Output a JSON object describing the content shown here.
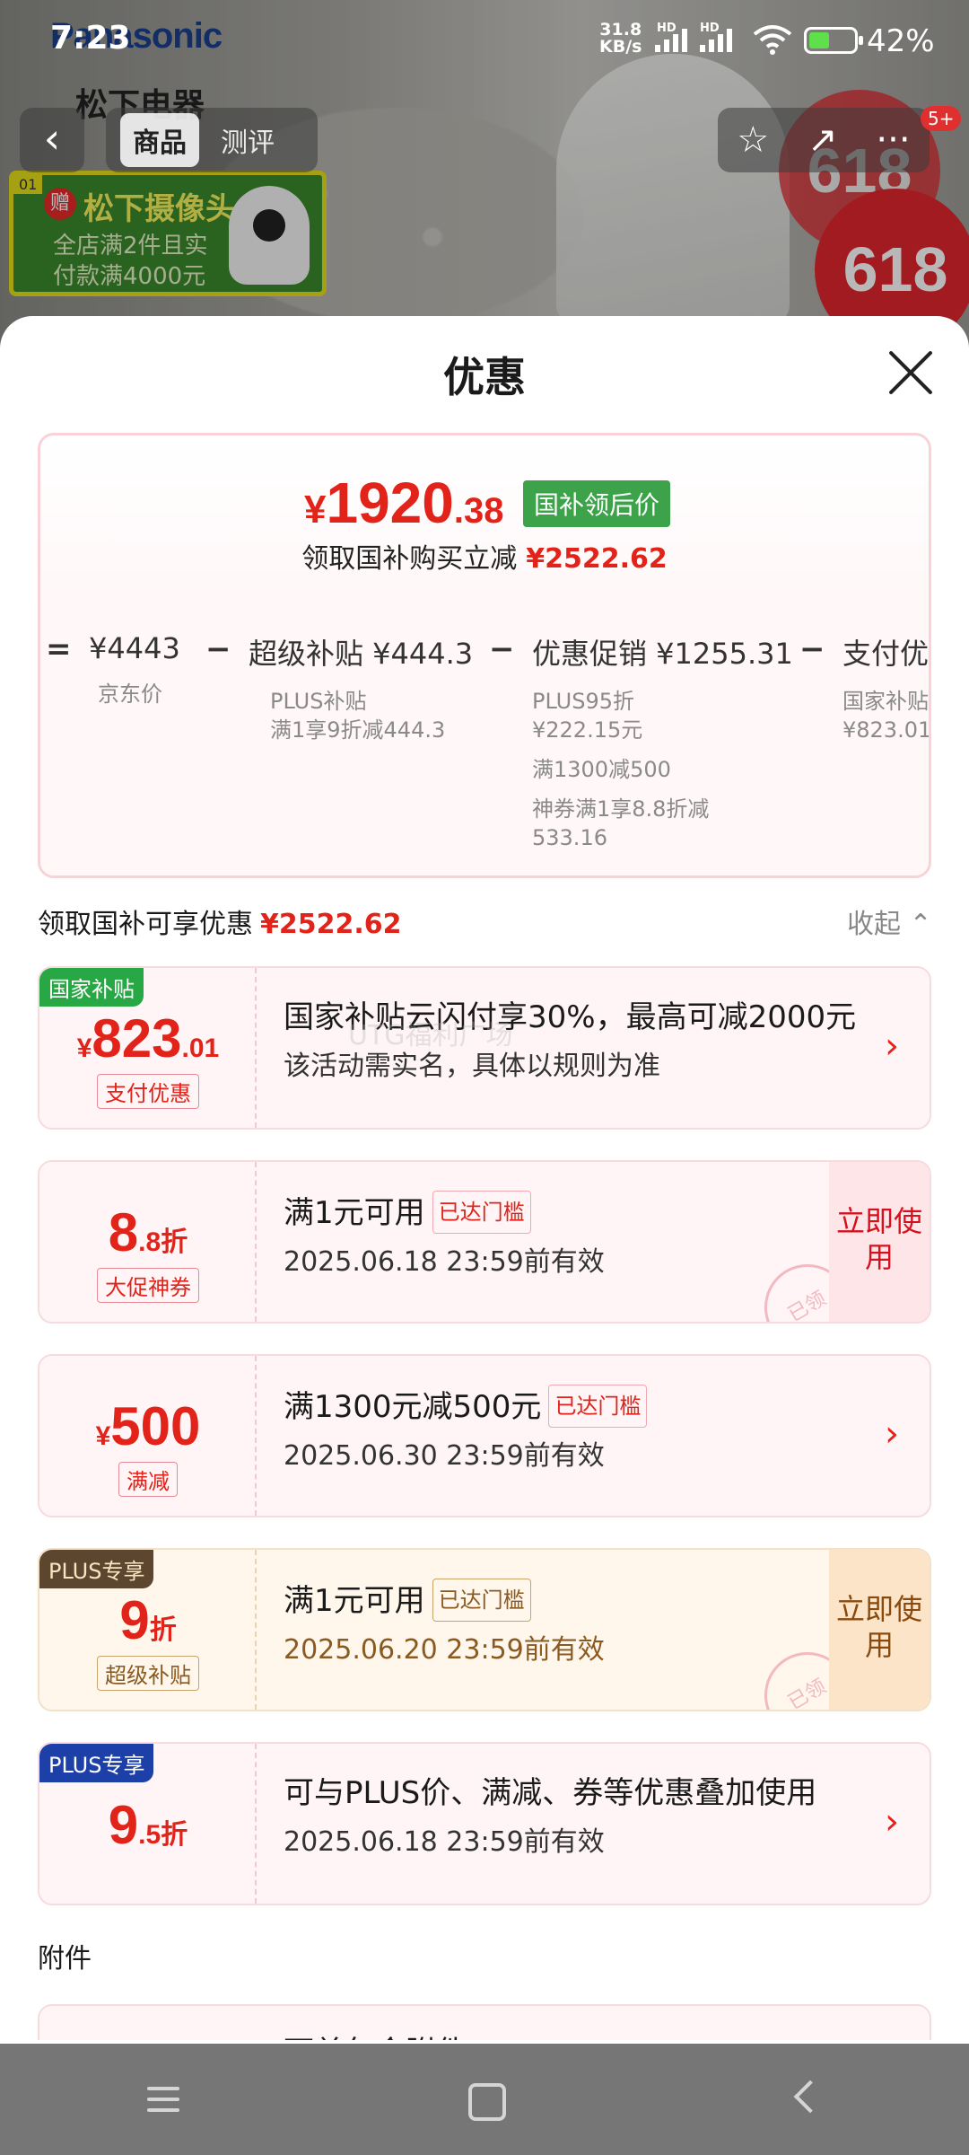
{
  "status_bar": {
    "time": "7:23",
    "net_speed": "31.8",
    "net_unit": "KB/s",
    "hd1": "HD",
    "hd2": "HD",
    "battery_pct": "42%"
  },
  "background": {
    "brand": "Panasonic",
    "brand_cn": "松下电器",
    "promo_tag": "01",
    "promo_zeng": "赠",
    "promo_title": "松下摄像头",
    "promo_line1": "全店满2件且实",
    "promo_line2": "付款满4000元",
    "badge": "618"
  },
  "nav": {
    "back_icon": "‹",
    "tabs": [
      "商品",
      "测评"
    ],
    "star_icon": "☆",
    "share_icon": "↗",
    "more_icon": "···",
    "msg_badge": "5+"
  },
  "sheet": {
    "title": "优惠",
    "price_box": {
      "currency": "¥",
      "price_int": "1920",
      "price_dec": ".38",
      "price_tag": "国补领后价",
      "sub_label": "领取国补购买立减",
      "sub_value": "¥2522.62",
      "breakdown": [
        {
          "op": "=",
          "head": "¥4443",
          "subs": [
            "京东价"
          ]
        },
        {
          "op": "−",
          "head": "超级补贴 ¥444.3",
          "subs": [
            "PLUS补贴\n满1享9折减444.3"
          ]
        },
        {
          "op": "−",
          "head": "优惠促销 ¥1255.31",
          "subs": [
            "PLUS95折\n¥222.15元",
            "满1300减500",
            "神券满1享8.8折减\n533.16"
          ]
        },
        {
          "op": "−",
          "head": "支付优",
          "subs": [
            "国家补贴\n¥823.01"
          ]
        }
      ]
    },
    "section": {
      "label": "领取国补可享优惠",
      "value": "¥2522.62",
      "collapse": "收起",
      "collapse_icon": "⌃"
    },
    "coupons": [
      {
        "corner": "国家补贴",
        "currency": "¥",
        "big": "823",
        "small": ".01",
        "label": "支付优惠",
        "line1": "国家补贴云闪付享30%，最高可减2000元",
        "line2": "该活动需实名，具体以规则为准",
        "arrow": "›"
      },
      {
        "big": "8",
        "small": ".8折",
        "label": "大促神券",
        "line1": "满1元可用",
        "pill": "已达门槛",
        "line2": "2025.06.18 23:59前有效",
        "button": "立即使用",
        "stamp": "已领"
      },
      {
        "currency": "¥",
        "big": "500",
        "label": "满减",
        "line1": "满1300元减500元",
        "pill": "已达门槛",
        "line2": "2025.06.30 23:59前有效",
        "arrow": "›"
      },
      {
        "corner": "PLUS专享",
        "big": "9",
        "small": "折",
        "label": "超级补贴",
        "line1": "满1元可用",
        "pill": "已达门槛",
        "line2": "2025.06.20 23:59前有效",
        "button": "立即使用",
        "stamp": "已领"
      },
      {
        "corner": "PLUS专享",
        "big": "9",
        "small": ".5折",
        "line1": "可与PLUS价、满减、券等优惠叠加使用",
        "line2": "2025.06.18 23:59前有效",
        "arrow": "›"
      }
    ],
    "attachments": {
      "label": "附件",
      "partial_text": "下单包含附件"
    }
  },
  "watermark": "UTG福利广场",
  "colors": {
    "accent_red": "#e2231a",
    "national_green": "#3da34a",
    "plus_brown": "#5c4630",
    "plus_blue": "#1d3fa8"
  }
}
